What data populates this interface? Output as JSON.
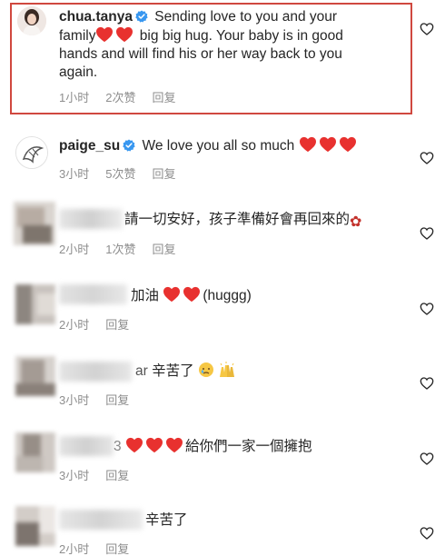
{
  "comments": [
    {
      "username": "chua.tanya",
      "verified": true,
      "text_lines": [
        "Sending love to you and your",
        "family",
        "big big hug. Your baby is in good",
        "hands and will find his or her way back to you",
        "again."
      ],
      "time": "1小时",
      "likes": "2次赞",
      "reply": "回复"
    },
    {
      "username": "paige_su",
      "verified": true,
      "text": "We love you all so much",
      "time": "3小时",
      "likes": "5次赞",
      "reply": "回复"
    },
    {
      "text": "請一切安好，孩子準備好會再回來的",
      "time": "2小时",
      "likes": "1次赞",
      "reply": "回复"
    },
    {
      "text": "加油",
      "text_after": "(huggg)",
      "time": "2小时",
      "reply": "回复"
    },
    {
      "name_tail": "ar",
      "text": "辛苦了",
      "time": "3小时",
      "reply": "回复"
    },
    {
      "name_tail": "3",
      "text": "給你們一家一個擁抱",
      "time": "3小时",
      "reply": "回复"
    },
    {
      "text": "辛苦了",
      "time": "2小时",
      "reply": "回复"
    }
  ],
  "icons": {
    "like": "heart-outline-icon",
    "verified": "verified-badge-icon",
    "emoji_heart": "red-heart-emoji",
    "emoji_rose": "rose-emoji",
    "emoji_sad": "crying-face-emoji",
    "emoji_hands": "raised-hands-emoji"
  },
  "colors": {
    "highlight": "#d0483f",
    "verified": "#3897f0",
    "heart": "#e8312f",
    "meta": "#8e8e8e"
  }
}
